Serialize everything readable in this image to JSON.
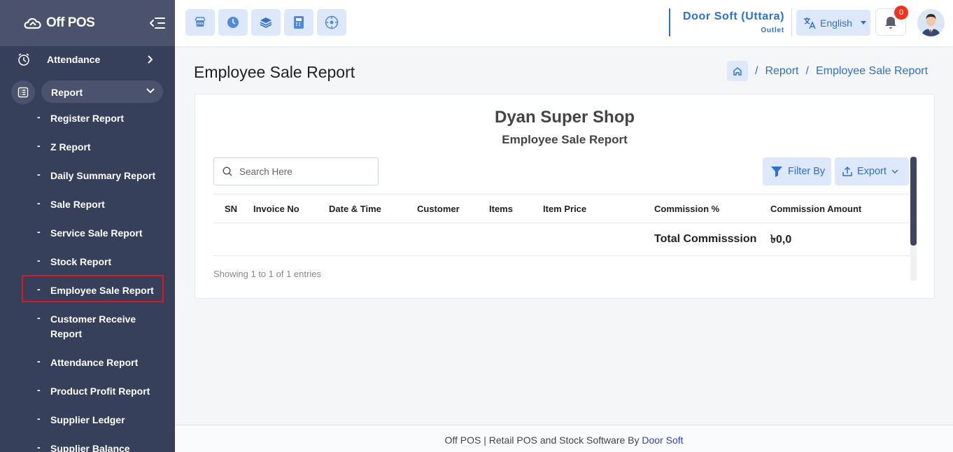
{
  "app": {
    "name": "Off POS"
  },
  "sidebar": {
    "attendance_label": "Attendance",
    "report_label": "Report",
    "items": [
      {
        "label": "Register Report"
      },
      {
        "label": "Z Report"
      },
      {
        "label": "Daily Summary Report"
      },
      {
        "label": "Sale Report"
      },
      {
        "label": "Service Sale Report"
      },
      {
        "label": "Stock Report"
      },
      {
        "label": "Employee Sale Report",
        "active": true
      },
      {
        "label": "Customer Receive Report"
      },
      {
        "label": "Attendance Report"
      },
      {
        "label": "Product Profit Report"
      },
      {
        "label": "Supplier Ledger"
      },
      {
        "label": "Supplier Balance Report"
      }
    ]
  },
  "topbar": {
    "quick_icons": [
      "pos-icon",
      "clock-icon",
      "layers-icon",
      "calculator-icon",
      "dashboard-icon"
    ],
    "outlet_name": "Door Soft (Uttara)",
    "outlet_sub": "Outlet",
    "language": "English",
    "notification_count": "0"
  },
  "page": {
    "title": "Employee Sale Report",
    "breadcrumb": [
      "Report",
      "Employee Sale Report"
    ]
  },
  "report": {
    "shop_name": "Dyan Super Shop",
    "title": "Employee Sale Report",
    "search_placeholder": "Search Here",
    "filter_label": "Filter By",
    "export_label": "Export",
    "columns": [
      "SN",
      "Invoice No",
      "Date & Time",
      "Customer",
      "Items",
      "Item Price",
      "Commission %",
      "Commission Amount"
    ],
    "total_label": "Total Commisssion",
    "total_value": "৳0,0",
    "showing": "Showing 1 to 1 of 1 entries"
  },
  "footer": {
    "text": "Off POS | Retail POS and Stock Software By ",
    "link": "Door Soft"
  },
  "colors": {
    "sidebar_bg": "#37405b",
    "accent": "#2c6fd8",
    "highlight": "#e0141e",
    "badge": "#f1331d"
  }
}
